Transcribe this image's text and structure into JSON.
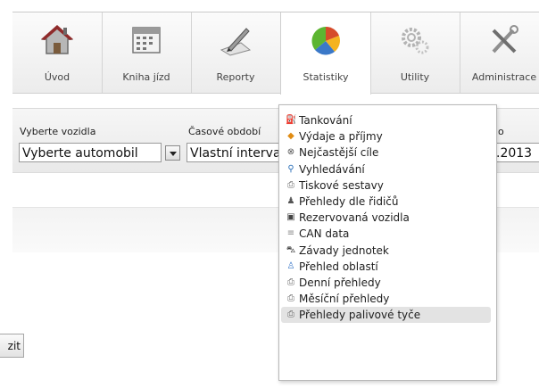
{
  "nav": {
    "items": [
      {
        "label": "Úvod",
        "icon": "house-icon"
      },
      {
        "label": "Kniha jízd",
        "icon": "calendar-icon"
      },
      {
        "label": "Reporty",
        "icon": "pencil-paper-icon"
      },
      {
        "label": "Statistiky",
        "icon": "pie-chart-icon"
      },
      {
        "label": "Utility",
        "icon": "gears-icon"
      },
      {
        "label": "Administrace",
        "icon": "tools-icon"
      }
    ],
    "active": "Statistiky"
  },
  "filters": {
    "vehicle_label": "Vyberte vozidla",
    "vehicle_value": "Vyberte automobil",
    "period_label": "Časové období",
    "period_value": "Vlastní interval",
    "date_label_fragment": "o",
    "date_value_fragment": ".2013"
  },
  "partial_button": "zit",
  "menu": {
    "items": [
      {
        "label": "Tankování",
        "icon": "fuel-icon"
      },
      {
        "label": "Výdaje a příjmy",
        "icon": "coins-icon"
      },
      {
        "label": "Nejčastější cíle",
        "icon": "target-icon"
      },
      {
        "label": "Vyhledávání",
        "icon": "search-icon"
      },
      {
        "label": "Tiskové sestavy",
        "icon": "printer-icon"
      },
      {
        "label": "Přehledy dle řidičů",
        "icon": "driver-icon"
      },
      {
        "label": "Rezervovaná vozidla",
        "icon": "reservation-icon"
      },
      {
        "label": "CAN data",
        "icon": "list-icon"
      },
      {
        "label": "Závady jednotek",
        "icon": "car-icon"
      },
      {
        "label": "Přehled oblastí",
        "icon": "area-icon"
      },
      {
        "label": "Denní přehledy",
        "icon": "printer-icon"
      },
      {
        "label": "Měsíční přehledy",
        "icon": "printer-icon"
      },
      {
        "label": "Přehledy palivové tyče",
        "icon": "printer-icon"
      }
    ],
    "highlighted": "Přehledy palivové tyče"
  },
  "colors": {
    "accent_red": "#d64b2a",
    "accent_green": "#5cb531",
    "accent_blue": "#3a78c8"
  }
}
